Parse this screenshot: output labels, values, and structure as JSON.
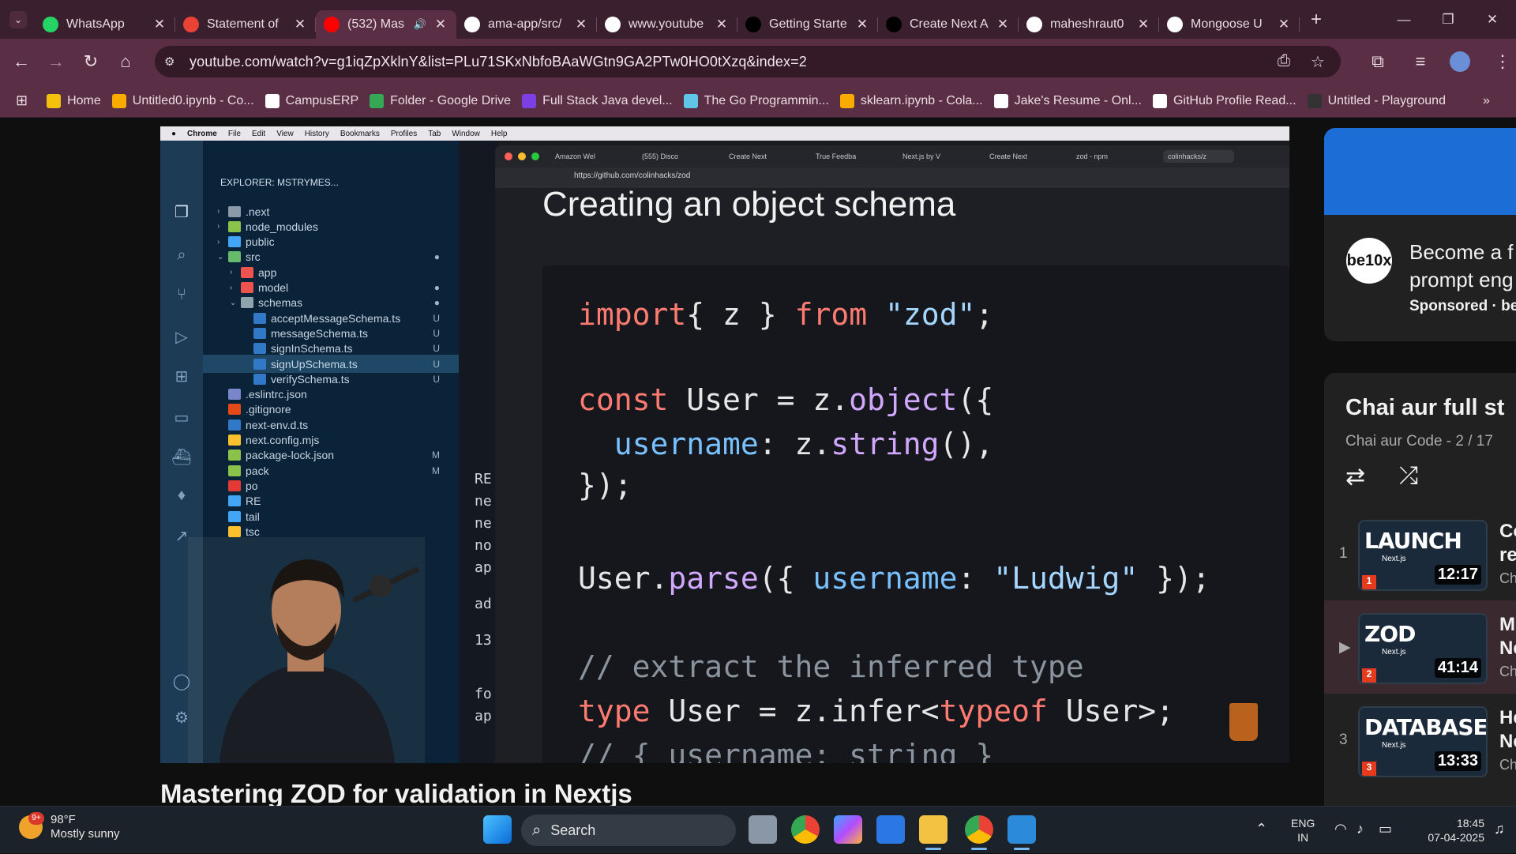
{
  "browser": {
    "tabs": [
      {
        "label": "WhatsApp",
        "icon": "whatsapp-icon",
        "color": "#25d366"
      },
      {
        "label": "Statement of",
        "icon": "gmail-icon",
        "color": "#ea4335"
      },
      {
        "label": "(532) Mas",
        "icon": "youtube-icon",
        "color": "#ff0000",
        "active": true
      },
      {
        "label": "ama-app/src/",
        "icon": "github-icon",
        "color": "#ffffff"
      },
      {
        "label": "www.youtube",
        "icon": "globe-icon",
        "color": "#ffffff"
      },
      {
        "label": "Getting Starte",
        "icon": "nextjs-icon",
        "color": "#000000"
      },
      {
        "label": "Create Next A",
        "icon": "vercel-icon",
        "color": "#000000"
      },
      {
        "label": "maheshraut0",
        "icon": "github-icon",
        "color": "#ffffff"
      },
      {
        "label": "Mongoose U",
        "icon": "openai-icon",
        "color": "#ffffff"
      }
    ],
    "url": "youtube.com/watch?v=g1iqZpXklnY&list=PLu71SKxNbfoBAaWGtn9GA2PTw0HO0tXzq&index=2",
    "bookmarks": [
      {
        "label": "Home",
        "color": "#f4c20d"
      },
      {
        "label": "Untitled0.ipynb - Co...",
        "color": "#f9ab00"
      },
      {
        "label": "CampusERP",
        "color": "#ffffff"
      },
      {
        "label": "Folder - Google Drive",
        "color": "#34a853"
      },
      {
        "label": "Full Stack Java devel...",
        "color": "#7b3fe4"
      },
      {
        "label": "The Go Programmin...",
        "color": "#5fc6e8"
      },
      {
        "label": "sklearn.ipynb - Cola...",
        "color": "#f9ab00"
      },
      {
        "label": "Jake's Resume - Onl...",
        "color": "#ffffff"
      },
      {
        "label": "GitHub Profile Read...",
        "color": "#ffffff"
      },
      {
        "label": "Untitled - Playground",
        "color": "#333333"
      }
    ]
  },
  "video": {
    "mac_menu": [
      "Chrome",
      "File",
      "Edit",
      "View",
      "History",
      "Bookmarks",
      "Profiles",
      "Tab",
      "Window",
      "Help"
    ],
    "explorer_header": "EXPLORER: MSTRYMES...",
    "files": [
      {
        "name": ".next",
        "indent": 0,
        "chev": ">",
        "color": "#8a9aa8",
        "badge": ""
      },
      {
        "name": "node_modules",
        "indent": 0,
        "chev": ">",
        "color": "#8bc34a",
        "badge": ""
      },
      {
        "name": "public",
        "indent": 0,
        "chev": ">",
        "color": "#42a5f5",
        "badge": ""
      },
      {
        "name": "src",
        "indent": 0,
        "chev": "v",
        "color": "#66bb6a",
        "badge": "●"
      },
      {
        "name": "app",
        "indent": 1,
        "chev": ">",
        "color": "#ef5350",
        "badge": ""
      },
      {
        "name": "model",
        "indent": 1,
        "chev": ">",
        "color": "#ef5350",
        "badge": "●"
      },
      {
        "name": "schemas",
        "indent": 1,
        "chev": "v",
        "color": "#90a4ae",
        "badge": "●"
      },
      {
        "name": "acceptMessageSchema.ts",
        "indent": 2,
        "chev": "",
        "color": "#3178c6",
        "badge": "U"
      },
      {
        "name": "messageSchema.ts",
        "indent": 2,
        "chev": "",
        "color": "#3178c6",
        "badge": "U"
      },
      {
        "name": "signInSchema.ts",
        "indent": 2,
        "chev": "",
        "color": "#3178c6",
        "badge": "U"
      },
      {
        "name": "signUpSchema.ts",
        "indent": 2,
        "chev": "",
        "color": "#3178c6",
        "badge": "U",
        "selected": true
      },
      {
        "name": "verifySchema.ts",
        "indent": 2,
        "chev": "",
        "color": "#3178c6",
        "badge": "U"
      },
      {
        "name": ".eslintrc.json",
        "indent": 0,
        "chev": "",
        "color": "#7986cb",
        "badge": ""
      },
      {
        "name": ".gitignore",
        "indent": 0,
        "chev": "",
        "color": "#e64a19",
        "badge": ""
      },
      {
        "name": "next-env.d.ts",
        "indent": 0,
        "chev": "",
        "color": "#3178c6",
        "badge": ""
      },
      {
        "name": "next.config.mjs",
        "indent": 0,
        "chev": "",
        "color": "#fbc02d",
        "badge": ""
      },
      {
        "name": "package-lock.json",
        "indent": 0,
        "chev": "",
        "color": "#8bc34a",
        "badge": "M"
      },
      {
        "name": "pack",
        "indent": 0,
        "chev": "",
        "color": "#8bc34a",
        "badge": "M"
      },
      {
        "name": "po",
        "indent": 0,
        "chev": "",
        "color": "#e53935",
        "badge": ""
      },
      {
        "name": "RE",
        "indent": 0,
        "chev": "",
        "color": "#42a5f5",
        "badge": ""
      },
      {
        "name": "tail",
        "indent": 0,
        "chev": "",
        "color": "#42a5f5",
        "badge": ""
      },
      {
        "name": "tsc",
        "indent": 0,
        "chev": "",
        "color": "#fbc02d",
        "badge": ""
      }
    ],
    "terminal_lines": [
      "RE",
      "ne",
      "ne",
      "no",
      "ap",
      "ad",
      "13",
      "fo",
      "ap"
    ],
    "inner_tabs": [
      "Amazon Wel",
      "(555) Disco",
      "Create Next",
      "True Feedba",
      "Next.js by V",
      "Create Next",
      "zod - npm",
      "colinhacks/z"
    ],
    "inner_url": "https://github.com/colinhacks/zod",
    "slide_title": "Creating an object schema",
    "code_lines": [
      {
        "parts": [
          [
            "kw",
            "import"
          ],
          [
            "",
            "{ z } "
          ],
          [
            "kw",
            "from"
          ],
          [
            "st",
            " \"zod\""
          ],
          [
            "",
            ";"
          ]
        ]
      },
      {
        "parts": [
          [
            "kw",
            "const"
          ],
          [
            "",
            " User = z."
          ],
          [
            "fn",
            "object"
          ],
          [
            "",
            "({"
          ]
        ]
      },
      {
        "parts": [
          [
            "pr",
            "  username"
          ],
          [
            "",
            ": z."
          ],
          [
            "fn",
            "string"
          ],
          [
            "",
            "(),"
          ]
        ]
      },
      {
        "parts": [
          [
            "",
            "});"
          ]
        ]
      },
      {
        "parts": [
          [
            "",
            "User."
          ],
          [
            "fn",
            "parse"
          ],
          [
            "",
            "({ "
          ],
          [
            "pr",
            "username"
          ],
          [
            "",
            ": "
          ],
          [
            "st",
            "\"Ludwig\""
          ],
          [
            "",
            " });"
          ]
        ]
      },
      {
        "parts": [
          [
            "cm",
            "// extract the inferred type"
          ]
        ]
      },
      {
        "parts": [
          [
            "kw",
            "type"
          ],
          [
            "",
            " User = z.infer<"
          ],
          [
            "kw",
            "typeof"
          ],
          [
            "",
            " User>;"
          ]
        ]
      },
      {
        "parts": [
          [
            "cm",
            "// { username: string }"
          ]
        ]
      }
    ]
  },
  "title": "Mastering ZOD for validation in Nextjs",
  "sidebar": {
    "ad_title_1": "Become a f",
    "ad_title_2": "prompt eng",
    "ad_sponsored": "Sponsored · be",
    "ad_logo": "be10x",
    "playlist_title": "Chai aur full st",
    "playlist_sub": "Chai aur Code - 2 / 17",
    "items": [
      {
        "index": "1",
        "thumb": "LAUNCH",
        "thumb_sub": "Next.js",
        "num": "1",
        "duration": "12:17",
        "title1": "Co",
        "title2": "re",
        "channel": "Ch"
      },
      {
        "index": "▶",
        "thumb": "ZOD",
        "thumb_sub": "Next.js",
        "num": "2",
        "duration": "41:14",
        "title1": "M",
        "title2": "Ne",
        "channel": "Ch",
        "current": true
      },
      {
        "index": "3",
        "thumb": "DATABASE",
        "thumb_sub": "Next.js",
        "num": "3",
        "duration": "13:33",
        "title1": "He",
        "title2": "Ne",
        "channel": "Ch"
      }
    ]
  },
  "taskbar": {
    "temp": "98°F",
    "weather": "Mostly sunny",
    "notif": "9+",
    "search": "Search",
    "lang1": "ENG",
    "lang2": "IN",
    "time": "18:45",
    "date": "07-04-2025"
  }
}
